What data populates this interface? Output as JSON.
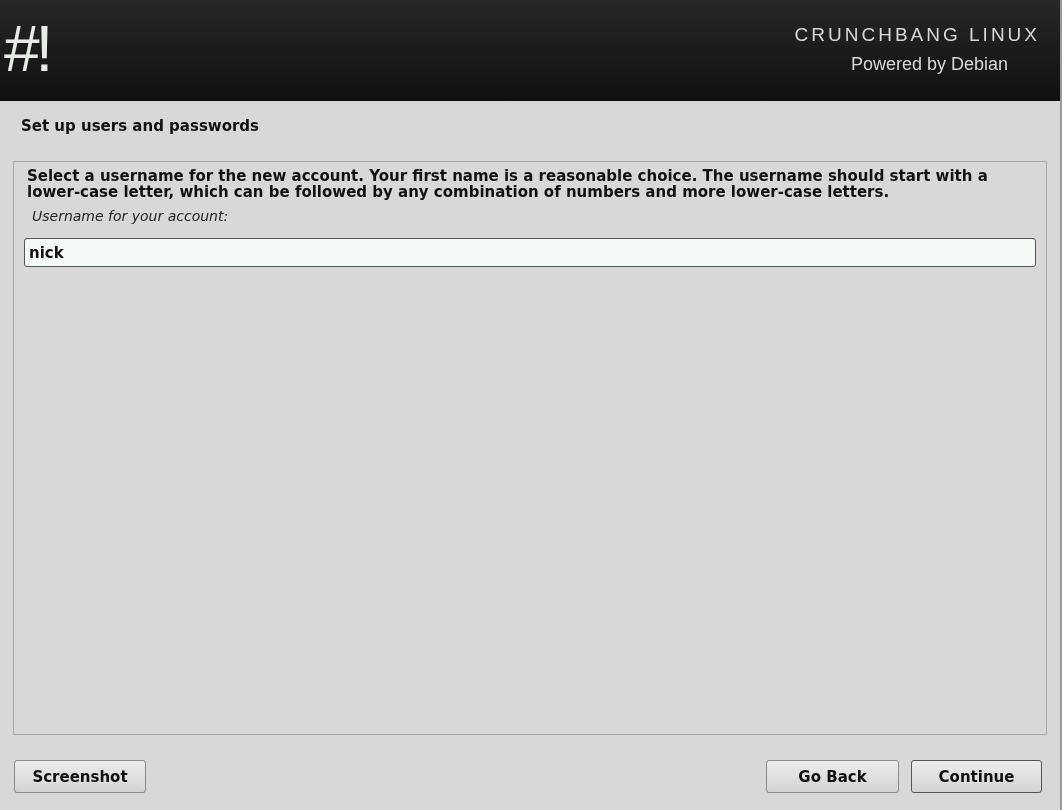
{
  "header": {
    "logo": "#!",
    "title": "CRUNCHBANG LINUX",
    "subtitle": "Powered by Debian"
  },
  "step_title": "Set up users and passwords",
  "panel": {
    "description": "Select a username for the new account. Your first name is a reasonable choice. The username should start with a lower-case letter, which can be followed by any combination of numbers and more lower-case letters.",
    "field_label": "Username for your account:",
    "field_value": "nick"
  },
  "buttons": [
    {
      "label": "Screenshot",
      "focused": false
    },
    {
      "label": "Go Back",
      "focused": false
    },
    {
      "label": "Continue",
      "focused": true
    }
  ]
}
